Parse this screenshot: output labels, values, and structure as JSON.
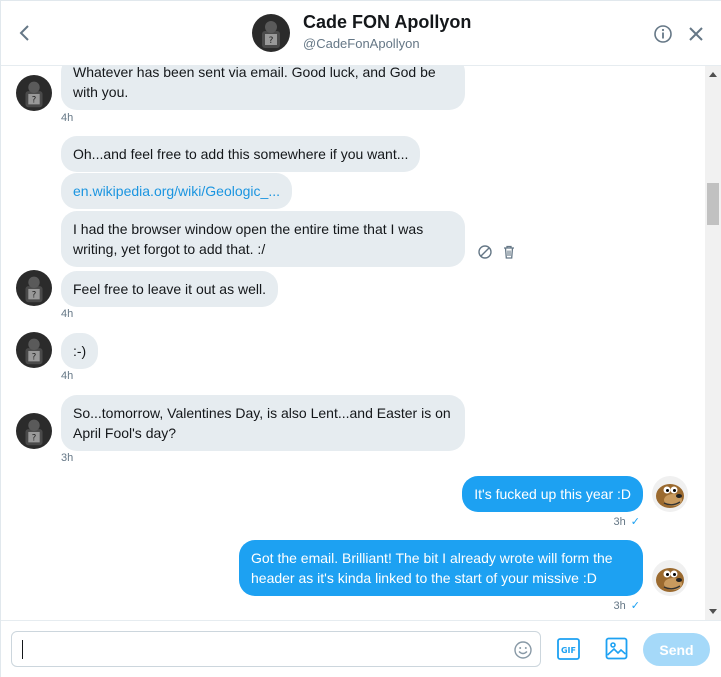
{
  "header": {
    "title": "Cade FON Apollyon",
    "handle": "@CadeFonApollyon"
  },
  "messages": [
    {
      "text": "Whatever has been sent via email. Good luck, and God be with you.",
      "time": "4h"
    },
    {
      "text": "Oh...and feel free to add this somewhere if you want..."
    },
    {
      "text": "en.wikipedia.org/wiki/Geologic_..."
    },
    {
      "text": "I had the browser window open the entire time that I was writing, yet forgot to add that. :/"
    },
    {
      "text": "Feel free to leave it out as well.",
      "time": "4h"
    },
    {
      "text": ":-)",
      "time": "4h"
    },
    {
      "text": "So...tomorrow, Valentines Day, is also Lent...and Easter is on April Fool's day?",
      "time": "3h"
    },
    {
      "text": "It's fucked up this year :D",
      "time": "3h"
    },
    {
      "text": "Got the email. Brilliant! The bit I already wrote will form the header as it's kinda linked to the start of your missive :D",
      "time": "3h"
    }
  ],
  "composer": {
    "value": "",
    "send_label": "Send",
    "gif_label": "GIF"
  },
  "colors": {
    "accent": "#1da1f2",
    "incoming_bubble": "#e6ecf0",
    "send_disabled": "#a5d9f9"
  },
  "icons": {
    "back": "chevron-left-icon",
    "info": "info-icon",
    "close": "close-icon",
    "emoji": "emoji-icon",
    "gif": "gif-icon",
    "media": "image-icon",
    "report": "block-icon",
    "delete": "trash-icon"
  }
}
